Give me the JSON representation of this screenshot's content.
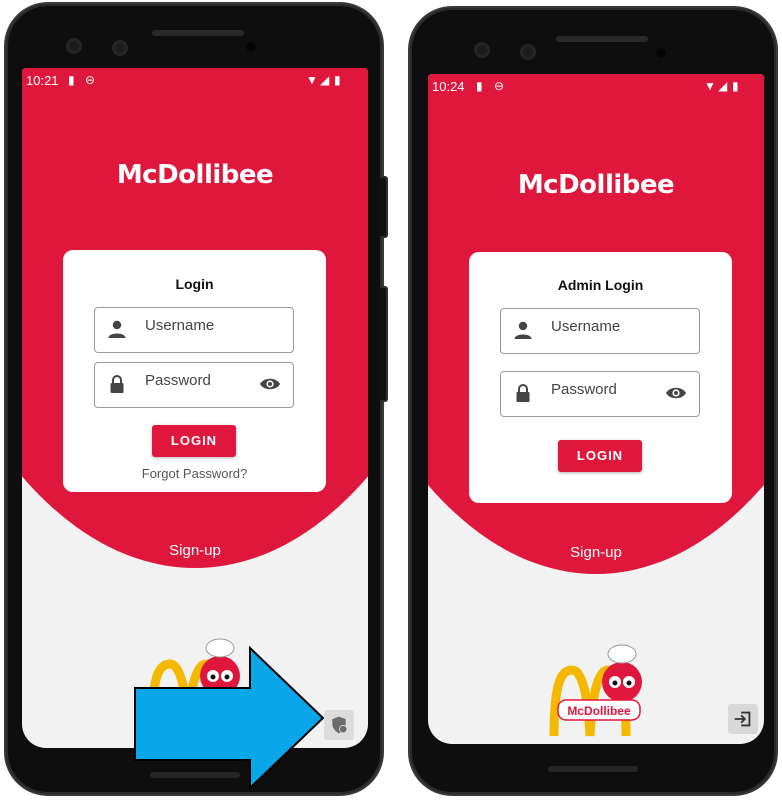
{
  "left_phone": {
    "status_time": "10:21",
    "brand": "McDollibee",
    "card_title": "Login",
    "username_placeholder": "Username",
    "password_placeholder": "Password",
    "login_label": "LOGIN",
    "forgot_label": "Forgot Password?",
    "signup_label": "Sign-up",
    "corner_icon": "admin-shield-icon"
  },
  "right_phone": {
    "status_time": "10:24",
    "brand": "McDollibee",
    "card_title": "Admin Login",
    "username_placeholder": "Username",
    "password_placeholder": "Password",
    "login_label": "LOGIN",
    "signup_label": "Sign-up",
    "corner_icon": "exit-to-app-icon"
  },
  "logo": {
    "text": "McDollibee"
  },
  "colors": {
    "brand_red": "#e0173d",
    "arrow_blue": "#0aa6ea",
    "background": "#f2f2f2"
  }
}
